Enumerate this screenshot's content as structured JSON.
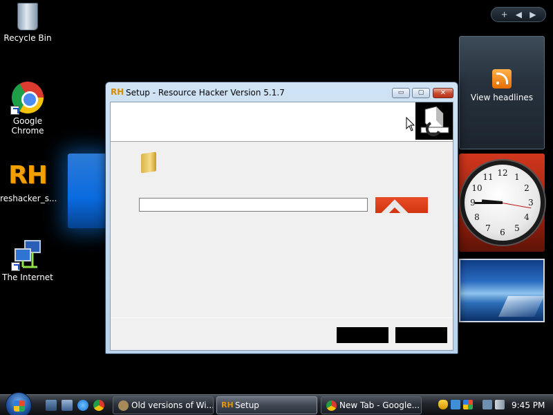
{
  "desktop": {
    "icons": [
      {
        "label": "Recycle Bin"
      },
      {
        "label": "Google\nChrome"
      },
      {
        "label": "reshacker_s...",
        "logo_text": "RH"
      },
      {
        "label": "The Internet"
      }
    ]
  },
  "sidebar": {
    "add_label": "+",
    "prev_label": "◀",
    "next_label": "▶",
    "feed_label": "View headlines",
    "clock_time": "9:45"
  },
  "window": {
    "icon_text": "RH",
    "title": "Setup - Resource Hacker Version 5.1.7",
    "minimize_label": "▭",
    "maximize_label": "▢",
    "close_label": "✕",
    "path_value": ""
  },
  "taskbar": {
    "tasks": [
      {
        "label": "Old versions of Wi..."
      },
      {
        "label": "Setup",
        "icon_text": "RH"
      },
      {
        "label": "New Tab - Google..."
      }
    ],
    "clock": "9:45 PM"
  },
  "colors": {
    "accent_browse": "#d2360f",
    "title_bar": "#cfe3f5",
    "desktop": "#000000"
  },
  "icons": [
    "recycle-bin-icon",
    "chrome-icon",
    "rh-icon",
    "network-icon",
    "feed-icon",
    "folder-icon",
    "windows-orb-icon"
  ]
}
